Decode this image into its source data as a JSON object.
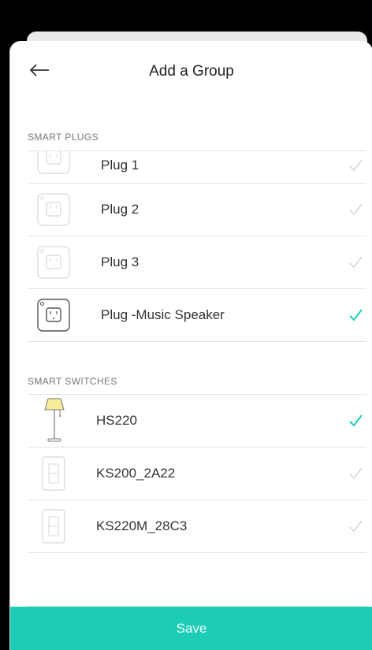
{
  "header": {
    "title": "Add a Group",
    "back_icon": "arrow-left-icon"
  },
  "sections": {
    "plugs_label": "SMART PLUGS",
    "switches_label": "SMART SWITCHES"
  },
  "plugs": [
    {
      "label": "Plug 1",
      "checked": false
    },
    {
      "label": "Plug 2",
      "checked": false
    },
    {
      "label": "Plug 3",
      "checked": false
    },
    {
      "label": "Plug -Music Speaker",
      "checked": true
    }
  ],
  "switches": [
    {
      "label": "HS220",
      "checked": true,
      "icon": "floor-lamp-icon"
    },
    {
      "label": "KS200_2A22",
      "checked": false,
      "icon": "wall-switch-icon"
    },
    {
      "label": "KS220M_28C3",
      "checked": false,
      "icon": "wall-switch-icon"
    }
  ],
  "footer": {
    "save_label": "Save"
  },
  "colors": {
    "accent": "#1ecdb5",
    "check_active": "#1ecdb5",
    "check_inactive": "#d6d6d6"
  }
}
